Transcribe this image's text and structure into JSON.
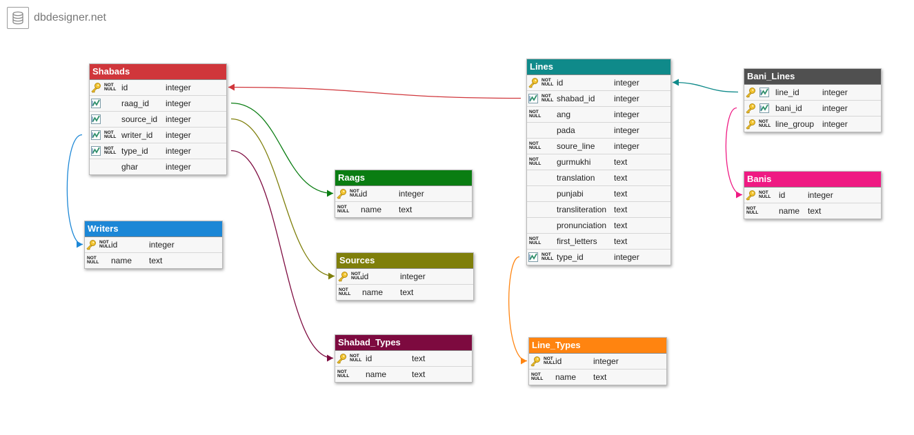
{
  "brand": {
    "name": "dbdesigner.net",
    "icon": "database-icon"
  },
  "tables": [
    {
      "id": "shabads",
      "name": "Shabads",
      "color": "#d0363b",
      "columns": [
        {
          "name": "id",
          "type": "integer",
          "pk": true,
          "fk": false,
          "nn": true
        },
        {
          "name": "raag_id",
          "type": "integer",
          "pk": false,
          "fk": true,
          "nn": false
        },
        {
          "name": "source_id",
          "type": "integer",
          "pk": false,
          "fk": true,
          "nn": false
        },
        {
          "name": "writer_id",
          "type": "integer",
          "pk": false,
          "fk": true,
          "nn": true
        },
        {
          "name": "type_id",
          "type": "integer",
          "pk": false,
          "fk": true,
          "nn": true
        },
        {
          "name": "ghar",
          "type": "integer",
          "pk": false,
          "fk": false,
          "nn": false
        }
      ]
    },
    {
      "id": "raags",
      "name": "Raags",
      "color": "#0a7d12",
      "columns": [
        {
          "name": "id",
          "type": "integer",
          "pk": true,
          "fk": false,
          "nn": true
        },
        {
          "name": "name",
          "type": "text",
          "pk": false,
          "fk": false,
          "nn": true
        }
      ]
    },
    {
      "id": "writers",
      "name": "Writers",
      "color": "#1c87d6",
      "columns": [
        {
          "name": "id",
          "type": "integer",
          "pk": true,
          "fk": false,
          "nn": true
        },
        {
          "name": "name",
          "type": "text",
          "pk": false,
          "fk": false,
          "nn": true
        }
      ]
    },
    {
      "id": "sources",
      "name": "Sources",
      "color": "#7f7f0b",
      "columns": [
        {
          "name": "id",
          "type": "integer",
          "pk": true,
          "fk": false,
          "nn": true
        },
        {
          "name": "name",
          "type": "text",
          "pk": false,
          "fk": false,
          "nn": true
        }
      ]
    },
    {
      "id": "shabad_types",
      "name": "Shabad_Types",
      "color": "#7d0a3f",
      "columns": [
        {
          "name": "id",
          "type": "text",
          "pk": true,
          "fk": false,
          "nn": true
        },
        {
          "name": "name",
          "type": "text",
          "pk": false,
          "fk": false,
          "nn": true
        }
      ]
    },
    {
      "id": "lines",
      "name": "Lines",
      "color": "#0f8a8a",
      "columns": [
        {
          "name": "id",
          "type": "integer",
          "pk": true,
          "fk": false,
          "nn": true
        },
        {
          "name": "shabad_id",
          "type": "integer",
          "pk": false,
          "fk": true,
          "nn": true
        },
        {
          "name": "ang",
          "type": "integer",
          "pk": false,
          "fk": false,
          "nn": true
        },
        {
          "name": "pada",
          "type": "integer",
          "pk": false,
          "fk": false,
          "nn": false
        },
        {
          "name": "soure_line",
          "type": "integer",
          "pk": false,
          "fk": false,
          "nn": true
        },
        {
          "name": "gurmukhi",
          "type": "text",
          "pk": false,
          "fk": false,
          "nn": true
        },
        {
          "name": "translation",
          "type": "text",
          "pk": false,
          "fk": false,
          "nn": false
        },
        {
          "name": "punjabi",
          "type": "text",
          "pk": false,
          "fk": false,
          "nn": false
        },
        {
          "name": "transliteration",
          "type": "text",
          "pk": false,
          "fk": false,
          "nn": false
        },
        {
          "name": "pronunciation",
          "type": "text",
          "pk": false,
          "fk": false,
          "nn": false
        },
        {
          "name": "first_letters",
          "type": "text",
          "pk": false,
          "fk": false,
          "nn": true
        },
        {
          "name": "type_id",
          "type": "integer",
          "pk": false,
          "fk": true,
          "nn": true
        }
      ]
    },
    {
      "id": "line_types",
      "name": "Line_Types",
      "color": "#ff8410",
      "columns": [
        {
          "name": "id",
          "type": "integer",
          "pk": true,
          "fk": false,
          "nn": true
        },
        {
          "name": "name",
          "type": "text",
          "pk": false,
          "fk": false,
          "nn": true
        }
      ]
    },
    {
      "id": "bani_lines",
      "name": "Bani_Lines",
      "color": "#505050",
      "columns": [
        {
          "name": "line_id",
          "type": "integer",
          "pk": true,
          "fk": true,
          "nn": false
        },
        {
          "name": "bani_id",
          "type": "integer",
          "pk": true,
          "fk": true,
          "nn": false
        },
        {
          "name": "line_group",
          "type": "integer",
          "pk": true,
          "fk": false,
          "nn": true
        }
      ]
    },
    {
      "id": "banis",
      "name": "Banis",
      "color": "#ef1a83",
      "columns": [
        {
          "name": "id",
          "type": "integer",
          "pk": true,
          "fk": false,
          "nn": true
        },
        {
          "name": "name",
          "type": "text",
          "pk": false,
          "fk": false,
          "nn": true
        }
      ]
    }
  ],
  "relations": [
    {
      "from_table": "lines",
      "from_column": "shabad_id",
      "to_table": "shabads",
      "to_column": "id",
      "color": "#d0363b"
    },
    {
      "from_table": "shabads",
      "from_column": "raag_id",
      "to_table": "raags",
      "to_column": "id",
      "color": "#0a7d12"
    },
    {
      "from_table": "shabads",
      "from_column": "source_id",
      "to_table": "sources",
      "to_column": "id",
      "color": "#7f7f0b"
    },
    {
      "from_table": "shabads",
      "from_column": "writer_id",
      "to_table": "writers",
      "to_column": "id",
      "color": "#1c87d6"
    },
    {
      "from_table": "shabads",
      "from_column": "type_id",
      "to_table": "shabad_types",
      "to_column": "id",
      "color": "#7d0a3f"
    },
    {
      "from_table": "lines",
      "from_column": "type_id",
      "to_table": "line_types",
      "to_column": "id",
      "color": "#ff8410"
    },
    {
      "from_table": "bani_lines",
      "from_column": "line_id",
      "to_table": "lines",
      "to_column": "id",
      "color": "#0f8a8a"
    },
    {
      "from_table": "bani_lines",
      "from_column": "bani_id",
      "to_table": "banis",
      "to_column": "id",
      "color": "#ef1a83"
    }
  ],
  "labels": {
    "not_null_top": "NOT",
    "not_null_bottom": "NULL"
  }
}
